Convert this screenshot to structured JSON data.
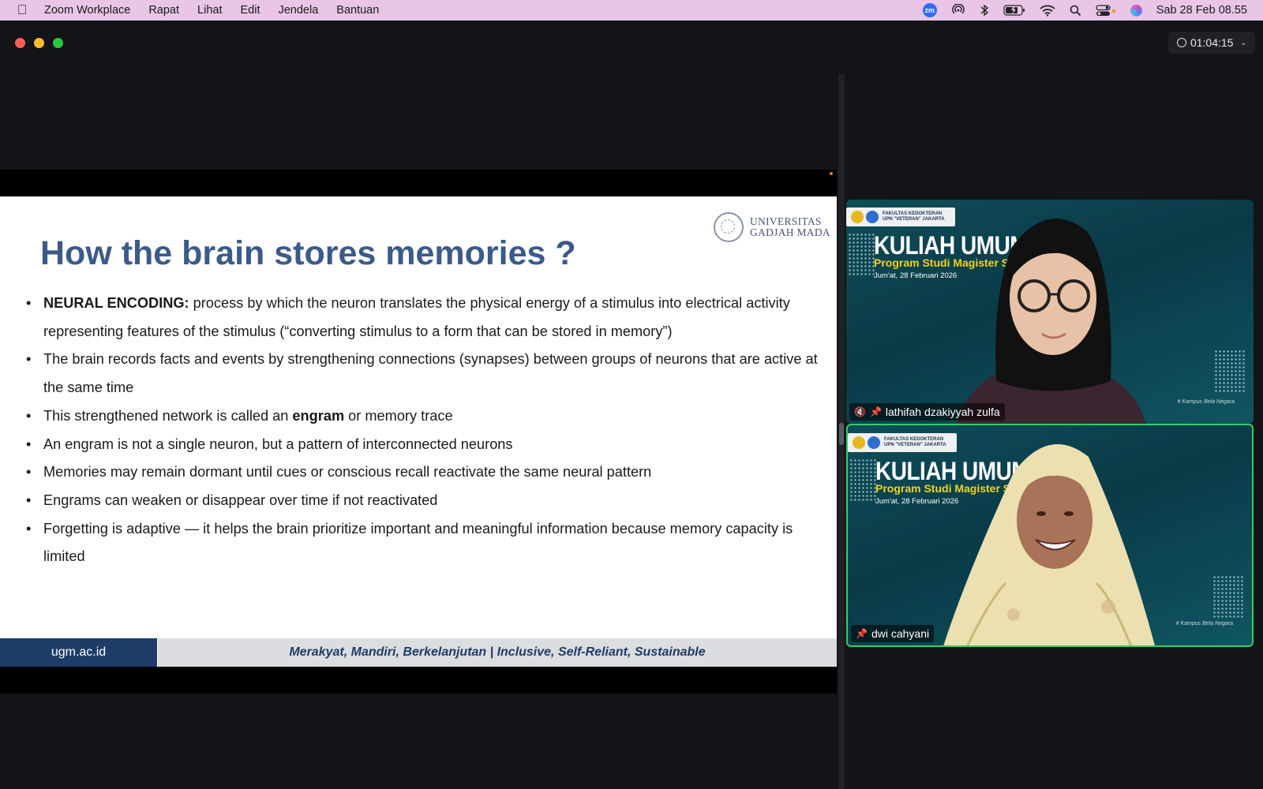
{
  "menubar": {
    "app_name": "Zoom Workplace",
    "menus": [
      "Rapat",
      "Lihat",
      "Edit",
      "Jendela",
      "Bantuan"
    ],
    "status_icons": [
      "zoom-icon",
      "airdrop-icon",
      "bluetooth-icon",
      "battery-icon",
      "wifi-icon",
      "spotlight-icon",
      "control-center-icon",
      "siri-icon"
    ],
    "zoom_badge": "zm",
    "datetime": "Sab 28 Feb  08.55"
  },
  "window": {
    "traffic_colors": {
      "close": "#fe5f57",
      "minimize": "#febc2e",
      "maximize": "#28c840"
    },
    "meeting_timer": "01:04:15"
  },
  "slide": {
    "title": "How the brain stores memories ?",
    "logo": {
      "line1": "UNIVERSITAS",
      "line2": "GADJAH MADA"
    },
    "bullets": [
      {
        "bold_prefix": "NEURAL ENCODING:",
        "text": " process by which the neuron translates the physical energy of a stimulus into electrical activity representing features of the stimulus (“converting stimulus to a form that can be stored in memory”)"
      },
      {
        "text": "The brain records facts and events by strengthening connections (synapses) between groups of neurons that are active at the same time"
      },
      {
        "before": "This strengthened network is called an ",
        "bold": "engram",
        "after": " or memory trace"
      },
      {
        "text": "An engram is not a single neuron, but a pattern of interconnected neurons"
      },
      {
        "text": "Memories may remain dormant until cues or conscious recall reactivate the same neural pattern"
      },
      {
        "text": "Engrams can weaken or disappear over time if not reactivated"
      },
      {
        "text": "Forgetting is adaptive — it helps the brain prioritize important and meaningful information because memory capacity is limited"
      }
    ],
    "footer": {
      "site": "ugm.ac.id",
      "motto": "Merakyat, Mandiri, Berkelanjutan | Inclusive, Self-Reliant, Sustainable"
    },
    "colors": {
      "title": "#3c5a8a",
      "footer_blue": "#1e3c67",
      "footer_gray": "#dcdde0"
    }
  },
  "participants": [
    {
      "name": "lathifah dzakiyyah zulfa",
      "muted": true,
      "pinned": true,
      "active_speaker": false,
      "background": {
        "faculty_tag": "FAKULTAS KEDOKTERAN",
        "university_tag": "UPN \"VETERAN\" JAKARTA",
        "headline": "KULIAH UMUM",
        "program": "Program Studi Magister Sa",
        "date": "Jum'at, 28 Februari 2026",
        "hashtag": "# Kampus Bela Negara"
      }
    },
    {
      "name": "dwi cahyani",
      "muted": false,
      "pinned": true,
      "active_speaker": true,
      "background": {
        "faculty_tag": "FAKULTAS KEDOKTERAN",
        "university_tag": "UPN \"VETERAN\" JAKARTA",
        "headline": "KULIAH UMUM",
        "program": "Program Studi Magister Sa",
        "date": "Jum'at, 28 Februari 2026",
        "hashtag": "# Kampus Bela Negara"
      }
    }
  ]
}
